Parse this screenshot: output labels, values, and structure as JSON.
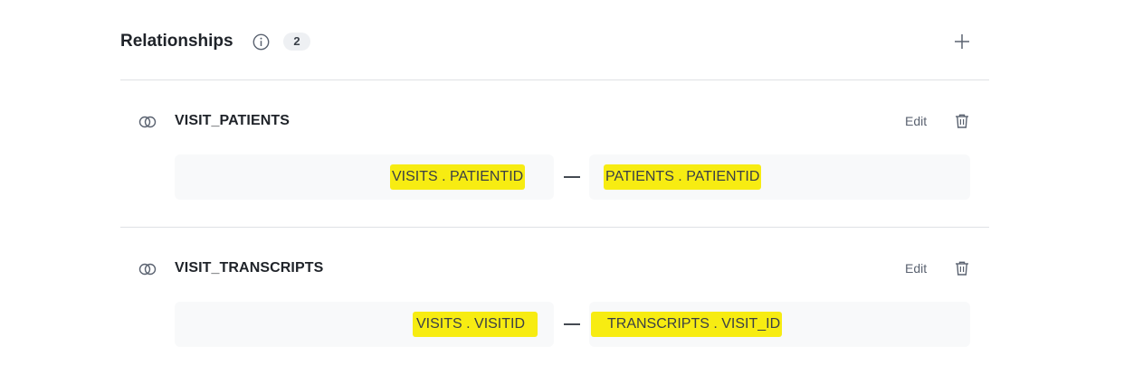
{
  "header": {
    "title": "Relationships",
    "count": "2"
  },
  "relationships": [
    {
      "name": "VISIT_PATIENTS",
      "edit_label": "Edit",
      "left_field": "VISITS . PATIENTID",
      "right_field": "PATIENTS . PATIENTID"
    },
    {
      "name": "VISIT_TRANSCRIPTS",
      "edit_label": "Edit",
      "left_field": "VISITS . VISITID",
      "right_field": "TRANSCRIPTS . VISIT_ID"
    }
  ],
  "colors": {
    "highlight": "#f7ec12",
    "divider": "#dfe1e5",
    "field_bg": "#f8f9fa"
  },
  "icons": {
    "info": "info-circle-icon",
    "add": "plus-icon",
    "relation": "link-rings-icon",
    "delete": "trash-icon"
  }
}
